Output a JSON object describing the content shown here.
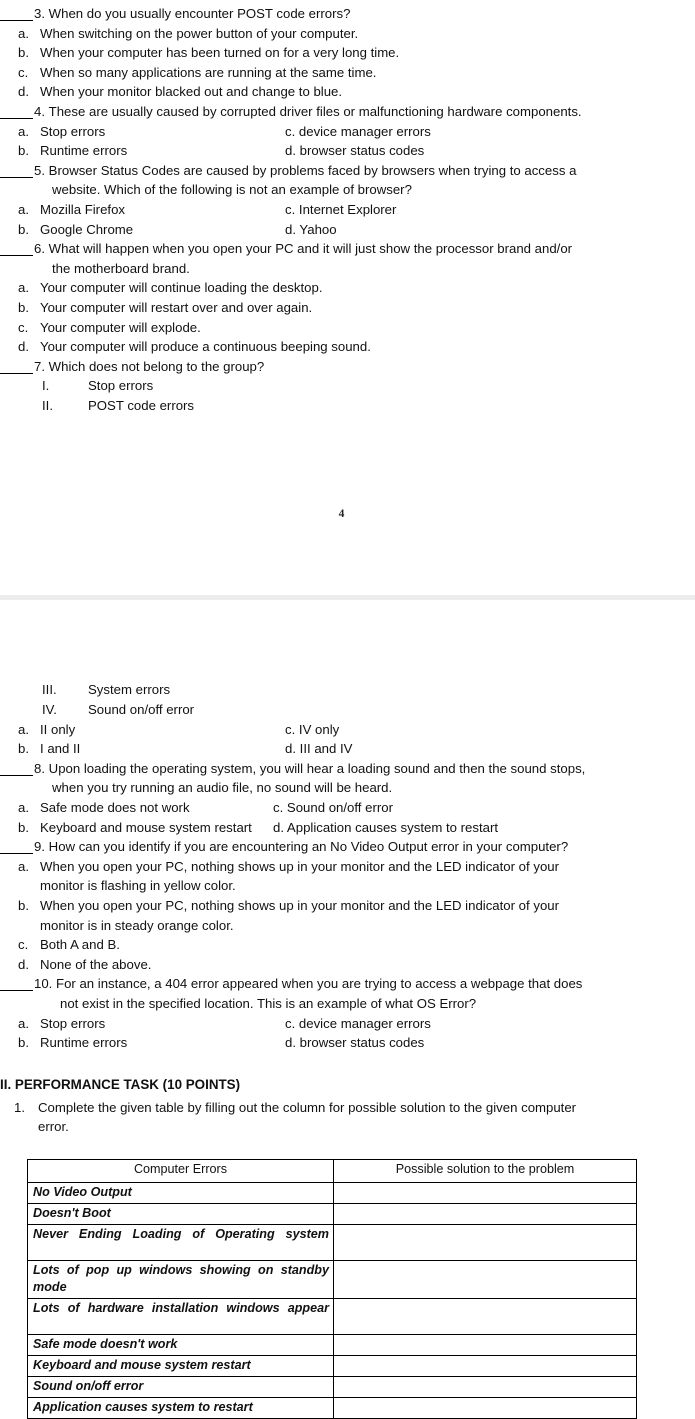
{
  "page1": {
    "page_number": "4",
    "questions": [
      {
        "blank": true,
        "number": "3.",
        "text": "When do you usually encounter POST code errors?",
        "continuation": null,
        "layout": "stacked",
        "choices": [
          {
            "letter": "a.",
            "text": "When switching on the power button of your computer."
          },
          {
            "letter": "b.",
            "text": "When your computer has been turned on for a very long time."
          },
          {
            "letter": "c.",
            "text": "When so many applications are running at the same time."
          },
          {
            "letter": "d.",
            "text": "When your monitor blacked out and change to blue."
          }
        ]
      },
      {
        "blank": true,
        "number": "4.",
        "text": "These are usually caused by corrupted driver files or malfunctioning hardware components.",
        "continuation": null,
        "layout": "two-column",
        "rows": [
          {
            "left_letter": "a.",
            "left_text": "Stop errors",
            "right_text": "c. device manager errors"
          },
          {
            "left_letter": "b.",
            "left_text": "Runtime errors",
            "right_text": "d. browser status codes"
          }
        ]
      },
      {
        "blank": true,
        "number": "5.",
        "text": "Browser Status Codes are caused by problems faced by browsers when trying to access a",
        "continuation": "website. Which of the following is not an example of browser?",
        "layout": "two-column",
        "rows": [
          {
            "left_letter": "a.",
            "left_text": "Mozilla Firefox",
            "right_text": "c. Internet Explorer"
          },
          {
            "left_letter": "b.",
            "left_text": "Google Chrome",
            "right_text": "d. Yahoo"
          }
        ]
      },
      {
        "blank": true,
        "number": "6.",
        "text": "What will happen when you open your PC and it will just show the processor brand and/or",
        "continuation": "the motherboard brand.",
        "layout": "stacked",
        "choices": [
          {
            "letter": "a.",
            "text": "Your computer will continue loading the desktop."
          },
          {
            "letter": "b.",
            "text": "Your computer will restart over and over again."
          },
          {
            "letter": "c.",
            "text": "Your computer will explode."
          },
          {
            "letter": "d.",
            "text": "Your computer will produce a continuous beeping sound."
          }
        ]
      },
      {
        "blank": true,
        "number": "7.",
        "text": "Which does not belong to the group?",
        "continuation": null,
        "layout": "roman",
        "roman_items": [
          {
            "numeral": "I.",
            "text": "Stop errors"
          },
          {
            "numeral": "II.",
            "text": "POST code errors"
          }
        ]
      }
    ]
  },
  "page2": {
    "roman_items_continued": [
      {
        "numeral": "III.",
        "text": "System errors"
      },
      {
        "numeral": "IV.",
        "text": "Sound on/off error"
      }
    ],
    "q7_choices": [
      {
        "left_letter": "a.",
        "left_text": "II only",
        "right_text": "c. IV only"
      },
      {
        "left_letter": "b.",
        "left_text": "I and II",
        "right_text": "d. III and IV"
      }
    ],
    "questions": [
      {
        "blank": true,
        "number": "8.",
        "text": "Upon loading the operating system, you will hear a loading sound and then the sound stops,",
        "continuation": "when you try running an audio file, no sound will be heard.",
        "rows": [
          {
            "left_letter": "a.",
            "left_text": "Safe mode does not work",
            "right_text": "c. Sound on/off error"
          },
          {
            "left_letter": "b.",
            "left_text": "Keyboard and mouse system restart",
            "right_text": "d. Application causes system to restart"
          }
        ]
      },
      {
        "blank": true,
        "number": "9.",
        "text": "How can you identify if you are encountering an No Video Output error in your computer?",
        "continuation": null,
        "choices": [
          {
            "letter": "a.",
            "text": "When you open your PC, nothing shows up in your monitor and the LED indicator of your",
            "wrap": "monitor is flashing in yellow color."
          },
          {
            "letter": "b.",
            "text": "When you open your PC, nothing shows up in your monitor and the LED indicator of your",
            "wrap": "monitor is in steady orange color."
          },
          {
            "letter": "c.",
            "text": "Both A and B.",
            "wrap": null
          },
          {
            "letter": "d.",
            "text": "None of the above.",
            "wrap": null
          }
        ]
      },
      {
        "blank": true,
        "number": "10.",
        "text": "For an instance, a 404 error appeared when you are trying to access a webpage that does",
        "continuation": "not exist in the specified location. This is an example of what OS Error?",
        "rows": [
          {
            "left_letter": "a.",
            "left_text": "Stop errors",
            "right_text": "c. device manager errors"
          },
          {
            "left_letter": "b.",
            "left_text": "Runtime errors",
            "right_text": "d. browser status codes"
          }
        ]
      }
    ],
    "performance_task": {
      "heading": "II. PERFORMANCE TASK (10 POINTS)",
      "item_number": "1.",
      "item_text": "Complete the given table by filling out the column for possible solution to the given computer",
      "item_text_wrap": "error."
    },
    "table": {
      "headers": [
        "Computer Errors",
        "Possible solution to the problem"
      ],
      "rows": [
        {
          "error": "No Video Output",
          "solution": "",
          "tall": false,
          "justify": false
        },
        {
          "error": "Doesn't Boot",
          "solution": "",
          "tall": false,
          "justify": false
        },
        {
          "error": "Never Ending Loading of Operating system",
          "solution": "",
          "tall": true,
          "justify": true
        },
        {
          "error": "Lots of pop up windows showing on standby mode",
          "solution": "",
          "tall": true,
          "justify": true
        },
        {
          "error": "Lots of hardware installation windows appear",
          "solution": "",
          "tall": true,
          "justify": true
        },
        {
          "error": "Safe mode doesn't work",
          "solution": "",
          "tall": false,
          "justify": false
        },
        {
          "error": "Keyboard and mouse system restart",
          "solution": "",
          "tall": false,
          "justify": false
        },
        {
          "error": "Sound on/off error",
          "solution": "",
          "tall": false,
          "justify": false
        },
        {
          "error": "Application causes system to restart",
          "solution": "",
          "tall": false,
          "justify": false
        }
      ]
    }
  }
}
